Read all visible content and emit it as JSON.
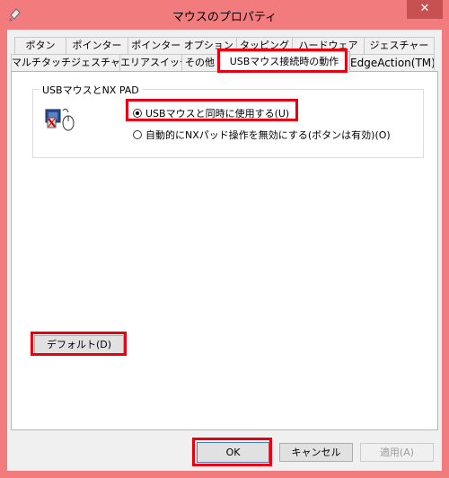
{
  "window": {
    "title": "マウスのプロパティ",
    "close_symbol": "✕"
  },
  "tabs": {
    "row_back": [
      "ボタン",
      "ポインター",
      "ポインター オプション",
      "タッピング",
      "ハードウェア",
      "ジェスチャー"
    ],
    "row_front": [
      "マルチタッチジェスチャー",
      "エリアスイッチ",
      "その他",
      "USBマウス接続時の動作",
      "EdgeAction(TM)"
    ],
    "active": "USBマウス接続時の動作"
  },
  "group": {
    "title": "USBマウスとNX PAD",
    "option1": "USBマウスと同時に使用する(U)",
    "option2": "自動的にNXパッド操作を無効にする(ボタンは有効)(O)",
    "selected": "option1"
  },
  "buttons": {
    "default": "デフォルト(D)",
    "ok": "OK",
    "cancel": "キャンセル",
    "apply": "適用(A)"
  },
  "colors": {
    "frame": "#f27c7d",
    "close": "#c75050",
    "highlight": "#e60012"
  }
}
